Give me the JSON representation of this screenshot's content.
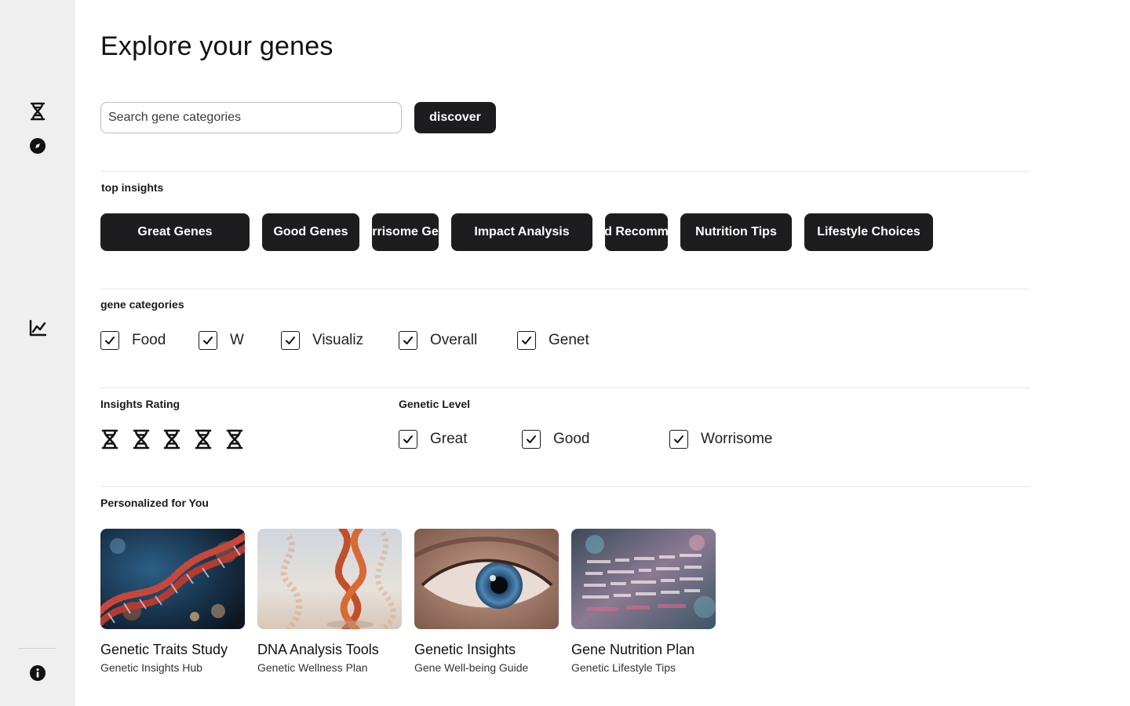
{
  "page": {
    "title": "Explore your genes"
  },
  "search": {
    "placeholder": "Search gene categories",
    "button_label": "discover"
  },
  "top_insights": {
    "label": "top insights",
    "chips": [
      "Great Genes",
      "Good Genes",
      "rrisome Ge",
      "Impact Analysis",
      "d Recomm",
      "Nutrition Tips",
      "Lifestyle Choices"
    ]
  },
  "gene_categories": {
    "label": "gene categories",
    "items": [
      "Food",
      "W",
      "Visualiz",
      "Overall",
      "Genet"
    ]
  },
  "insights_rating": {
    "label": "Insights Rating",
    "stars": 5
  },
  "genetic_level": {
    "label": "Genetic Level",
    "items": [
      "Great",
      "Good",
      "Worrisome"
    ]
  },
  "personalized": {
    "label": "Personalized for You",
    "cards": [
      {
        "title": "Genetic Traits Study",
        "subtitle": "Genetic Insights Hub"
      },
      {
        "title": "DNA Analysis Tools",
        "subtitle": "Genetic Wellness Plan"
      },
      {
        "title": "Genetic Insights",
        "subtitle": "Gene Well-being Guide"
      },
      {
        "title": "Gene Nutrition Plan",
        "subtitle": "Genetic Lifestyle Tips"
      }
    ]
  },
  "sidebar": {
    "icons": [
      "dna-icon",
      "compass-icon",
      "chart-icon",
      "info-icon"
    ]
  },
  "colors": {
    "sidebar_bg": "#efefef",
    "chip_bg": "#1d1d1f",
    "divider": "#e6e6e6"
  }
}
